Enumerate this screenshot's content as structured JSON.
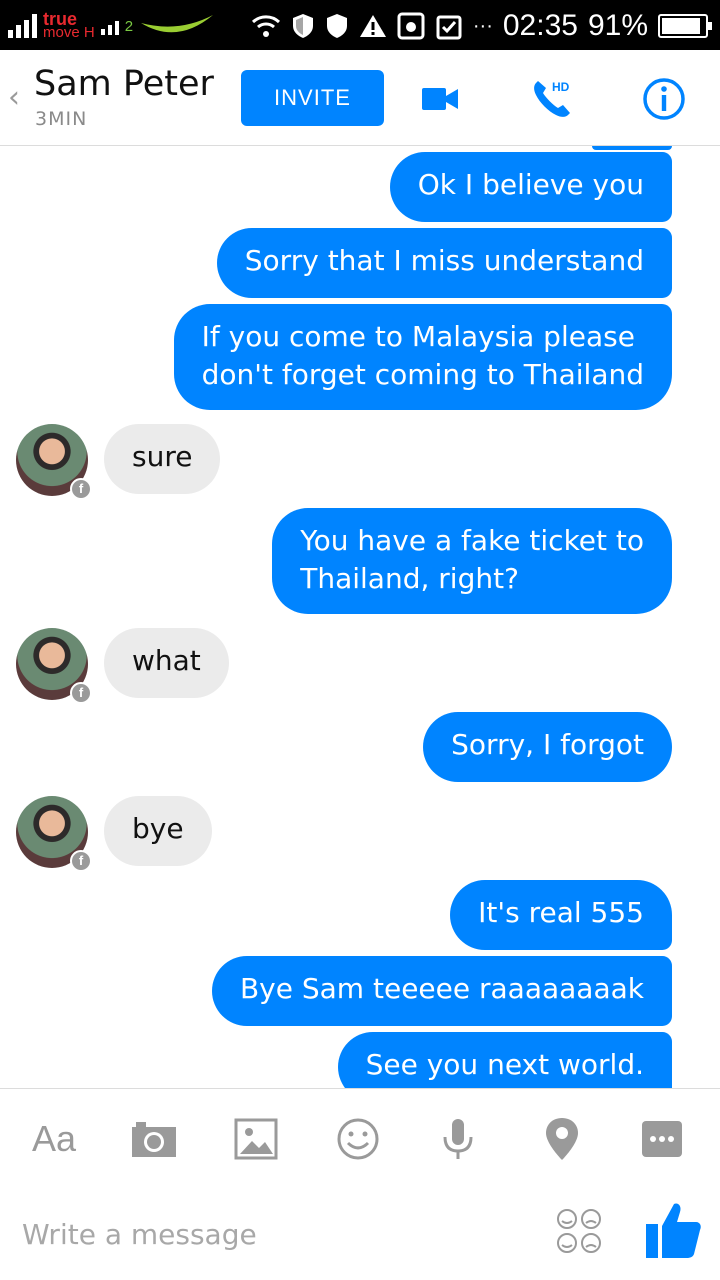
{
  "status_bar": {
    "carrier_line1": "true",
    "carrier_line2": "move H",
    "network_badge": "2",
    "more_dots": "···",
    "time": "02:35",
    "battery": "91%",
    "battery_level": 0.91
  },
  "header": {
    "back_glyph": "‹",
    "contact_name": "Sam Peter",
    "contact_status": "3MIN",
    "invite_label": "INVITE",
    "hd_badge": "HD",
    "icons": [
      "back-chevron-icon",
      "video-camera-icon",
      "phone-hd-icon",
      "info-icon"
    ]
  },
  "messages": [
    {
      "from": "me",
      "text": "Ok I believe you"
    },
    {
      "from": "me",
      "text": "Sorry that I miss understand"
    },
    {
      "from": "me",
      "lines": [
        "If you come to Malaysia please",
        "don't forget coming to Thailand"
      ]
    },
    {
      "from": "them",
      "text": "sure"
    },
    {
      "from": "me",
      "lines": [
        "You have a fake ticket to",
        "Thailand, right?"
      ]
    },
    {
      "from": "them",
      "text": "what"
    },
    {
      "from": "me",
      "text": "Sorry, I forgot"
    },
    {
      "from": "them",
      "text": "bye"
    },
    {
      "from": "me",
      "text": "It's real 555"
    },
    {
      "from": "me",
      "text": "Bye Sam teeeee raaaaaaaak"
    },
    {
      "from": "me",
      "text": "See you next world."
    }
  ],
  "toolbar": {
    "text_tool_label": "Aa",
    "icons": [
      "camera-icon",
      "gallery-icon",
      "emoji-icon",
      "microphone-icon",
      "location-pin-icon",
      "more-icon"
    ]
  },
  "composer": {
    "placeholder": "Write a message",
    "value": ""
  },
  "colors": {
    "accent": "#0084ff",
    "incoming_bubble": "#ebebeb",
    "icon_gray": "#9a9a9a",
    "carrier_red": "#e8292f"
  }
}
